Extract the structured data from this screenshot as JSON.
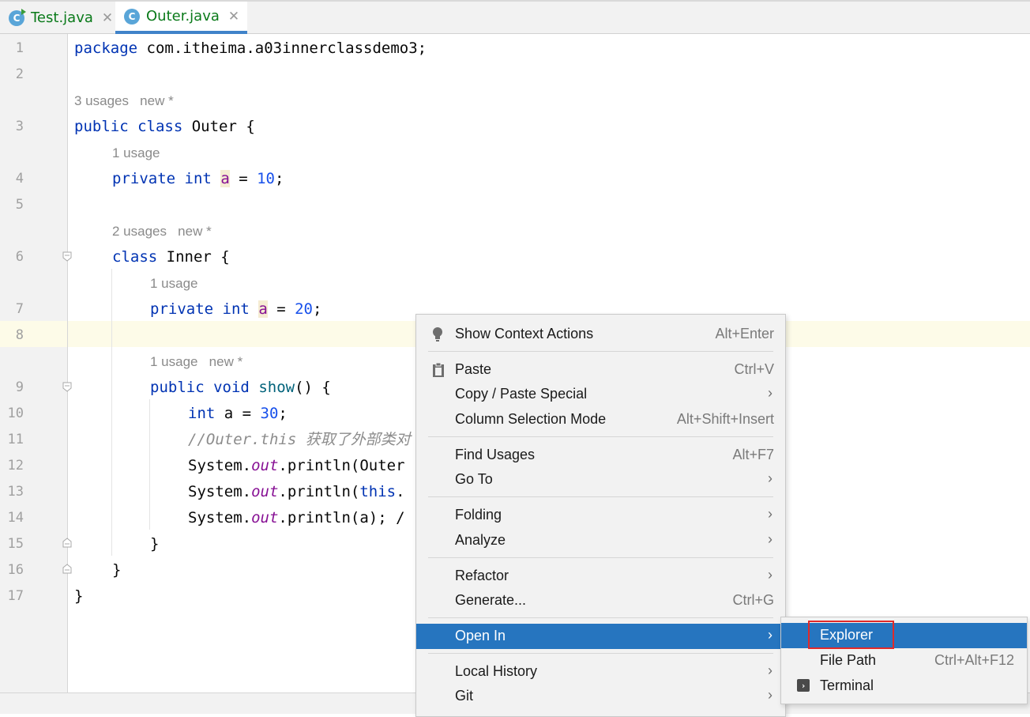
{
  "tabs": [
    {
      "name": "Test.java",
      "icon": "C"
    },
    {
      "name": "Outer.java",
      "icon": "C"
    }
  ],
  "tab_close_glyph": "✕",
  "line_numbers": [
    "1",
    "2",
    "3",
    "4",
    "5",
    "6",
    "7",
    "8",
    "9",
    "10",
    "11",
    "12",
    "13",
    "14",
    "15",
    "16",
    "17"
  ],
  "code": {
    "l1_a": "package",
    "l1_b": " com.itheima.a03innerclassdemo3;",
    "hint_outer_usages": "3 usages",
    "hint_outer_new": "new *",
    "l3_a": "public",
    "l3_b": " ",
    "l3_c": "class",
    "l3_d": " Outer {",
    "hint_a1": "1 usage",
    "l4_a": "private",
    "l4_b": " ",
    "l4_c": "int",
    "l4_d": " ",
    "l4_e": "a",
    "l4_f": " = ",
    "l4_g": "10",
    "l4_h": ";",
    "hint_inner_usages": "2 usages",
    "hint_inner_new": "new *",
    "l6_a": "class",
    "l6_b": " Inner {",
    "hint_a2": "1 usage",
    "l7_a": "private",
    "l7_b": " ",
    "l7_c": "int",
    "l7_d": " ",
    "l7_e": "a",
    "l7_f": " = ",
    "l7_g": "20",
    "l7_h": ";",
    "hint_show_usages": "1 usage",
    "hint_show_new": "new *",
    "l9_a": "public",
    "l9_b": " ",
    "l9_c": "void",
    "l9_d": " ",
    "l9_e": "show",
    "l9_f": "() {",
    "l10_a": "int",
    "l10_b": " a = ",
    "l10_c": "30",
    "l10_d": ";",
    "l11": "//Outer.this 获取了外部类对",
    "l12_a": "System.",
    "l12_b": "out",
    "l12_c": ".println(Outer",
    "l13_a": "System.",
    "l13_b": "out",
    "l13_c": ".println(",
    "l13_d": "this",
    "l13_e": ".",
    "l14_a": "System.",
    "l14_b": "out",
    "l14_c": ".println(a); /",
    "l15": "}",
    "l16": "}",
    "l17": "}"
  },
  "context_menu": {
    "items": [
      {
        "label": "Show Context Actions",
        "shortcut": "Alt+Enter",
        "icon": "lightbulb-icon"
      },
      {
        "label": "Paste",
        "shortcut": "Ctrl+V",
        "icon": "clipboard-icon"
      },
      {
        "label": "Copy / Paste Special",
        "submenu": true
      },
      {
        "label": "Column Selection Mode",
        "shortcut": "Alt+Shift+Insert"
      },
      {
        "label": "Find Usages",
        "shortcut": "Alt+F7"
      },
      {
        "label": "Go To",
        "submenu": true
      },
      {
        "label": "Folding",
        "submenu": true
      },
      {
        "label": "Analyze",
        "submenu": true
      },
      {
        "label": "Refactor",
        "submenu": true
      },
      {
        "label": "Generate...",
        "shortcut": "Ctrl+G"
      },
      {
        "label": "Open In",
        "submenu": true,
        "selected": true
      },
      {
        "label": "Local History",
        "submenu": true
      },
      {
        "label": "Git",
        "submenu": true
      }
    ],
    "arrow_glyph": "›"
  },
  "open_in_submenu": {
    "items": [
      {
        "label": "Explorer",
        "selected": true,
        "highlighted_box": true
      },
      {
        "label": "File Path",
        "shortcut": "Ctrl+Alt+F12"
      },
      {
        "label": "Terminal",
        "icon": "terminal-icon"
      }
    ]
  },
  "colors": {
    "keyword": "#0033b3",
    "number": "#1750eb",
    "field": "#871094",
    "comment": "#8c8c8c",
    "selection": "#2675bf",
    "highlight_box": "#e02a2a",
    "current_line": "#fdfbe8"
  }
}
